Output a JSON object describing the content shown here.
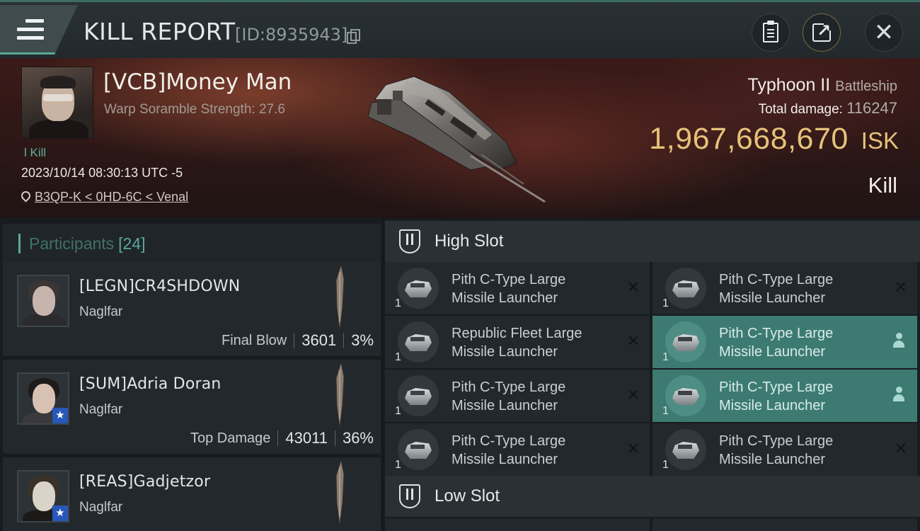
{
  "header": {
    "title": "KILL REPORT",
    "report_id": "[ID:8935943]"
  },
  "victim": {
    "name": "[VCB]Money Man",
    "scramble": "Warp Soramble Strength: 27.6",
    "kill_tag": "l Kill",
    "datetime": "2023/10/14 08:30:13 UTC -5",
    "location": "B3QP-K < 0HD-6C < Venal",
    "ship": "Typhoon II",
    "ship_class": "Battleship",
    "total_damage_label": "Total damage:",
    "total_damage": "116247",
    "isk_value": "1,967,668,670",
    "isk_unit": "ISK",
    "result": "Kill"
  },
  "participants": {
    "label": "Participants",
    "count": "[24]",
    "rows": [
      {
        "name": "[LEGN]CR4SHDOWN",
        "ship": "Naglfar",
        "tag": "Final Blow",
        "damage": "3601",
        "percent": "3%"
      },
      {
        "name": "[SUM]Adria Doran",
        "ship": "Naglfar",
        "tag": "Top Damage",
        "damage": "43011",
        "percent": "36%"
      },
      {
        "name": "[REAS]Gadjetzor",
        "ship": "Naglfar"
      }
    ]
  },
  "high_slot": {
    "label": "High Slot",
    "modules": [
      {
        "line1": "Pith C-Type Large",
        "line2": "Missile Launcher",
        "qty": "1"
      },
      {
        "line1": "Pith C-Type Large",
        "line2": "Missile Launcher",
        "qty": "1"
      },
      {
        "line1": "Republic Fleet Large",
        "line2": "Missile Launcher",
        "qty": "1"
      },
      {
        "line1": "Pith C-Type Large",
        "line2": "Missile Launcher",
        "qty": "1"
      },
      {
        "line1": "Pith C-Type Large",
        "line2": "Missile Launcher",
        "qty": "1"
      },
      {
        "line1": "Pith C-Type Large",
        "line2": "Missile Launcher",
        "qty": "1"
      },
      {
        "line1": "Pith C-Type Large",
        "line2": "Missile Launcher",
        "qty": "1"
      },
      {
        "line1": "Pith C-Type Large",
        "line2": "Missile Launcher",
        "qty": "1"
      }
    ]
  },
  "low_slot": {
    "label": "Low Slot"
  },
  "icons": {
    "menu": "hamburger-menu-icon",
    "copy": "copy-icon",
    "clipboard": "clipboard-icon",
    "share": "share-icon",
    "close": "close-icon",
    "location": "location-pin-icon",
    "destroyed": "x-icon",
    "dropped": "person-icon"
  },
  "colors": {
    "accent": "#5aa89c",
    "isk": "#e6c27a",
    "fitted_bg": "#3d7b72"
  }
}
